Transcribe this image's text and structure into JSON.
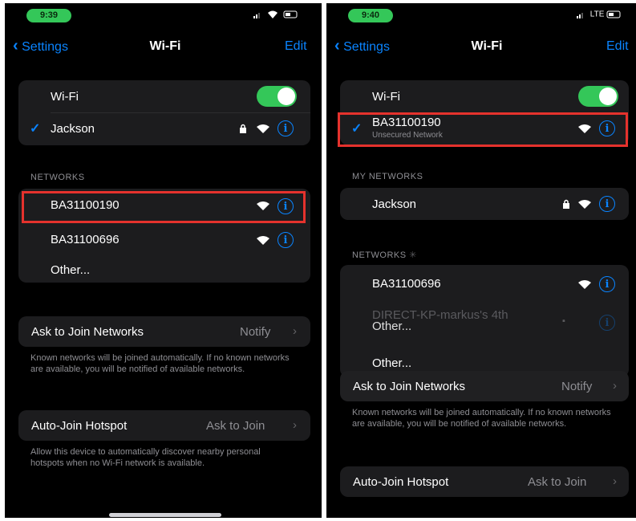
{
  "left": {
    "status_time": "9:39",
    "nav": {
      "back": "Settings",
      "title": "Wi-Fi",
      "edit": "Edit"
    },
    "wifi_label": "Wi-Fi",
    "connected": "Jackson",
    "networks_header": "NETWORKS",
    "networks": [
      "BA31100190",
      "BA31100696"
    ],
    "other": "Other...",
    "ask_to_join": {
      "label": "Ask to Join Networks",
      "value": "Notify"
    },
    "ask_footer": "Known networks will be joined automatically. If no known networks are available, you will be notified of available networks.",
    "auto_join": {
      "label": "Auto-Join Hotspot",
      "value": "Ask to Join"
    },
    "auto_footer": "Allow this device to automatically discover nearby personal hotspots when no Wi-Fi network is available."
  },
  "right": {
    "status_time": "9:40",
    "status_net": "LTE",
    "nav": {
      "back": "Settings",
      "title": "Wi-Fi",
      "edit": "Edit"
    },
    "wifi_label": "Wi-Fi",
    "connected": "BA31100190",
    "connected_sub": "Unsecured Network",
    "my_networks_header": "MY NETWORKS",
    "my_network": "Jackson",
    "networks_header": "NETWORKS",
    "network": "BA31100696",
    "ghost_network": "DIRECT-KP-markus's 4th",
    "ghost_other": "Other...",
    "other": "Other...",
    "ask_to_join": {
      "label": "Ask to Join Networks",
      "value": "Notify"
    },
    "ask_footer": "Known networks will be joined automatically. If no known networks are available, you will be notified of available networks.",
    "auto_join": {
      "label": "Auto-Join Hotspot",
      "value": "Ask to Join"
    }
  },
  "icons": {
    "wifi": "wifi-icon",
    "lock": "lock-icon",
    "info": "info-icon",
    "chevron": "chevron-right-icon",
    "check": "checkmark-icon"
  },
  "colors": {
    "accent": "#0a84ff",
    "toggle_on": "#34c759",
    "highlight": "#e5322d",
    "background": "#000000",
    "group": "#1c1c1e"
  }
}
